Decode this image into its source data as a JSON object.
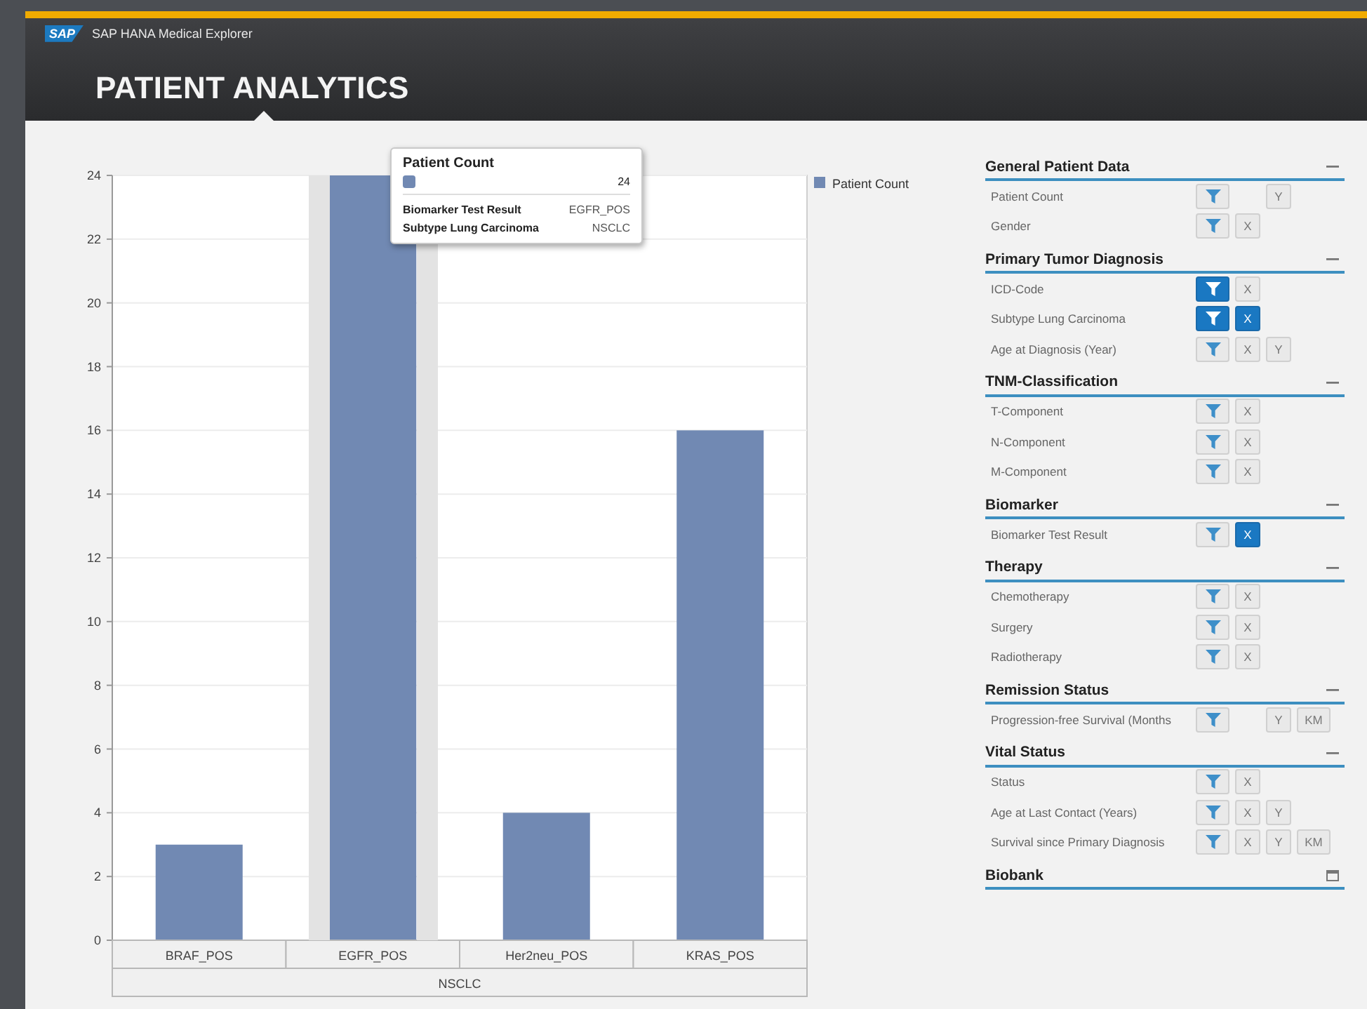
{
  "header": {
    "logo": "SAP",
    "app_name": "SAP HANA Medical Explorer",
    "title": "PATIENT ANALYTICS"
  },
  "chart": {
    "chart_data": {
      "type": "bar",
      "categories": [
        "BRAF_POS",
        "EGFR_POS",
        "Her2neu_POS",
        "KRAS_POS"
      ],
      "series": [
        {
          "name": "Patient Count",
          "color": "#7189b3",
          "values": [
            3,
            24,
            4,
            16
          ]
        }
      ],
      "grid": true,
      "ylim": [
        0,
        24
      ],
      "yticks": [
        0,
        2,
        4,
        6,
        8,
        10,
        12,
        14,
        16,
        18,
        20,
        22,
        24
      ]
    },
    "hovered": [
      false,
      true,
      false,
      false
    ],
    "x_group": "NSCLC",
    "tooltip": {
      "title": "Patient Count",
      "value": "24",
      "details": [
        {
          "label": "Biomarker Test Result",
          "value": "EGFR_POS"
        },
        {
          "label": "Subtype Lung Carcinoma",
          "value": "NSCLC"
        }
      ]
    }
  },
  "panel": {
    "sections": [
      {
        "title": "General Patient Data",
        "expanded": true,
        "rows": [
          {
            "label": "Patient Count",
            "buttons": [
              {
                "kind": "filter",
                "selected": false
              },
              {
                "kind": "y",
                "label": "Y",
                "selected": false
              }
            ]
          },
          {
            "label": "Gender",
            "buttons": [
              {
                "kind": "filter",
                "selected": false
              },
              {
                "kind": "x",
                "label": "X",
                "selected": false
              }
            ]
          }
        ]
      },
      {
        "title": "Primary Tumor Diagnosis",
        "expanded": true,
        "rows": [
          {
            "label": "ICD-Code",
            "buttons": [
              {
                "kind": "filter",
                "selected": true
              },
              {
                "kind": "x",
                "label": "X",
                "selected": false
              }
            ]
          },
          {
            "label": "Subtype Lung Carcinoma",
            "buttons": [
              {
                "kind": "filter",
                "selected": true
              },
              {
                "kind": "x",
                "label": "X",
                "selected": true
              }
            ]
          },
          {
            "label": "Age at Diagnosis (Year)",
            "buttons": [
              {
                "kind": "filter",
                "selected": false
              },
              {
                "kind": "x",
                "label": "X",
                "selected": false
              },
              {
                "kind": "y",
                "label": "Y",
                "selected": false
              }
            ]
          }
        ]
      },
      {
        "title": "TNM-Classification",
        "expanded": true,
        "rows": [
          {
            "label": "T-Component",
            "buttons": [
              {
                "kind": "filter",
                "selected": false
              },
              {
                "kind": "x",
                "label": "X",
                "selected": false
              }
            ]
          },
          {
            "label": "N-Component",
            "buttons": [
              {
                "kind": "filter",
                "selected": false
              },
              {
                "kind": "x",
                "label": "X",
                "selected": false
              }
            ]
          },
          {
            "label": "M-Component",
            "buttons": [
              {
                "kind": "filter",
                "selected": false
              },
              {
                "kind": "x",
                "label": "X",
                "selected": false
              }
            ]
          }
        ]
      },
      {
        "title": "Biomarker",
        "expanded": true,
        "rows": [
          {
            "label": "Biomarker Test Result",
            "buttons": [
              {
                "kind": "filter",
                "selected": false
              },
              {
                "kind": "x",
                "label": "X",
                "selected": true
              }
            ]
          }
        ]
      },
      {
        "title": "Therapy",
        "expanded": true,
        "rows": [
          {
            "label": "Chemotherapy",
            "buttons": [
              {
                "kind": "filter",
                "selected": false
              },
              {
                "kind": "x",
                "label": "X",
                "selected": false
              }
            ]
          },
          {
            "label": "Surgery",
            "buttons": [
              {
                "kind": "filter",
                "selected": false
              },
              {
                "kind": "x",
                "label": "X",
                "selected": false
              }
            ]
          },
          {
            "label": "Radiotherapy",
            "buttons": [
              {
                "kind": "filter",
                "selected": false
              },
              {
                "kind": "x",
                "label": "X",
                "selected": false
              }
            ]
          }
        ]
      },
      {
        "title": "Remission Status",
        "expanded": true,
        "rows": [
          {
            "label": "Progression-free Survival (Months",
            "buttons": [
              {
                "kind": "filter",
                "selected": false
              },
              {
                "kind": "y",
                "label": "Y",
                "selected": false
              },
              {
                "kind": "km",
                "label": "KM",
                "selected": false
              }
            ]
          }
        ]
      },
      {
        "title": "Vital Status",
        "expanded": true,
        "rows": [
          {
            "label": "Status",
            "buttons": [
              {
                "kind": "filter",
                "selected": false
              },
              {
                "kind": "x",
                "label": "X",
                "selected": false
              }
            ]
          },
          {
            "label": "Age at Last Contact (Years)",
            "buttons": [
              {
                "kind": "filter",
                "selected": false
              },
              {
                "kind": "x",
                "label": "X",
                "selected": false
              },
              {
                "kind": "y",
                "label": "Y",
                "selected": false
              }
            ]
          },
          {
            "label": "Survival since Primary Diagnosis",
            "buttons": [
              {
                "kind": "filter",
                "selected": false
              },
              {
                "kind": "x",
                "label": "X",
                "selected": false
              },
              {
                "kind": "y",
                "label": "Y",
                "selected": false
              },
              {
                "kind": "km",
                "label": "KM",
                "selected": false
              }
            ]
          }
        ]
      },
      {
        "title": "Biobank",
        "expanded": false
      }
    ]
  }
}
